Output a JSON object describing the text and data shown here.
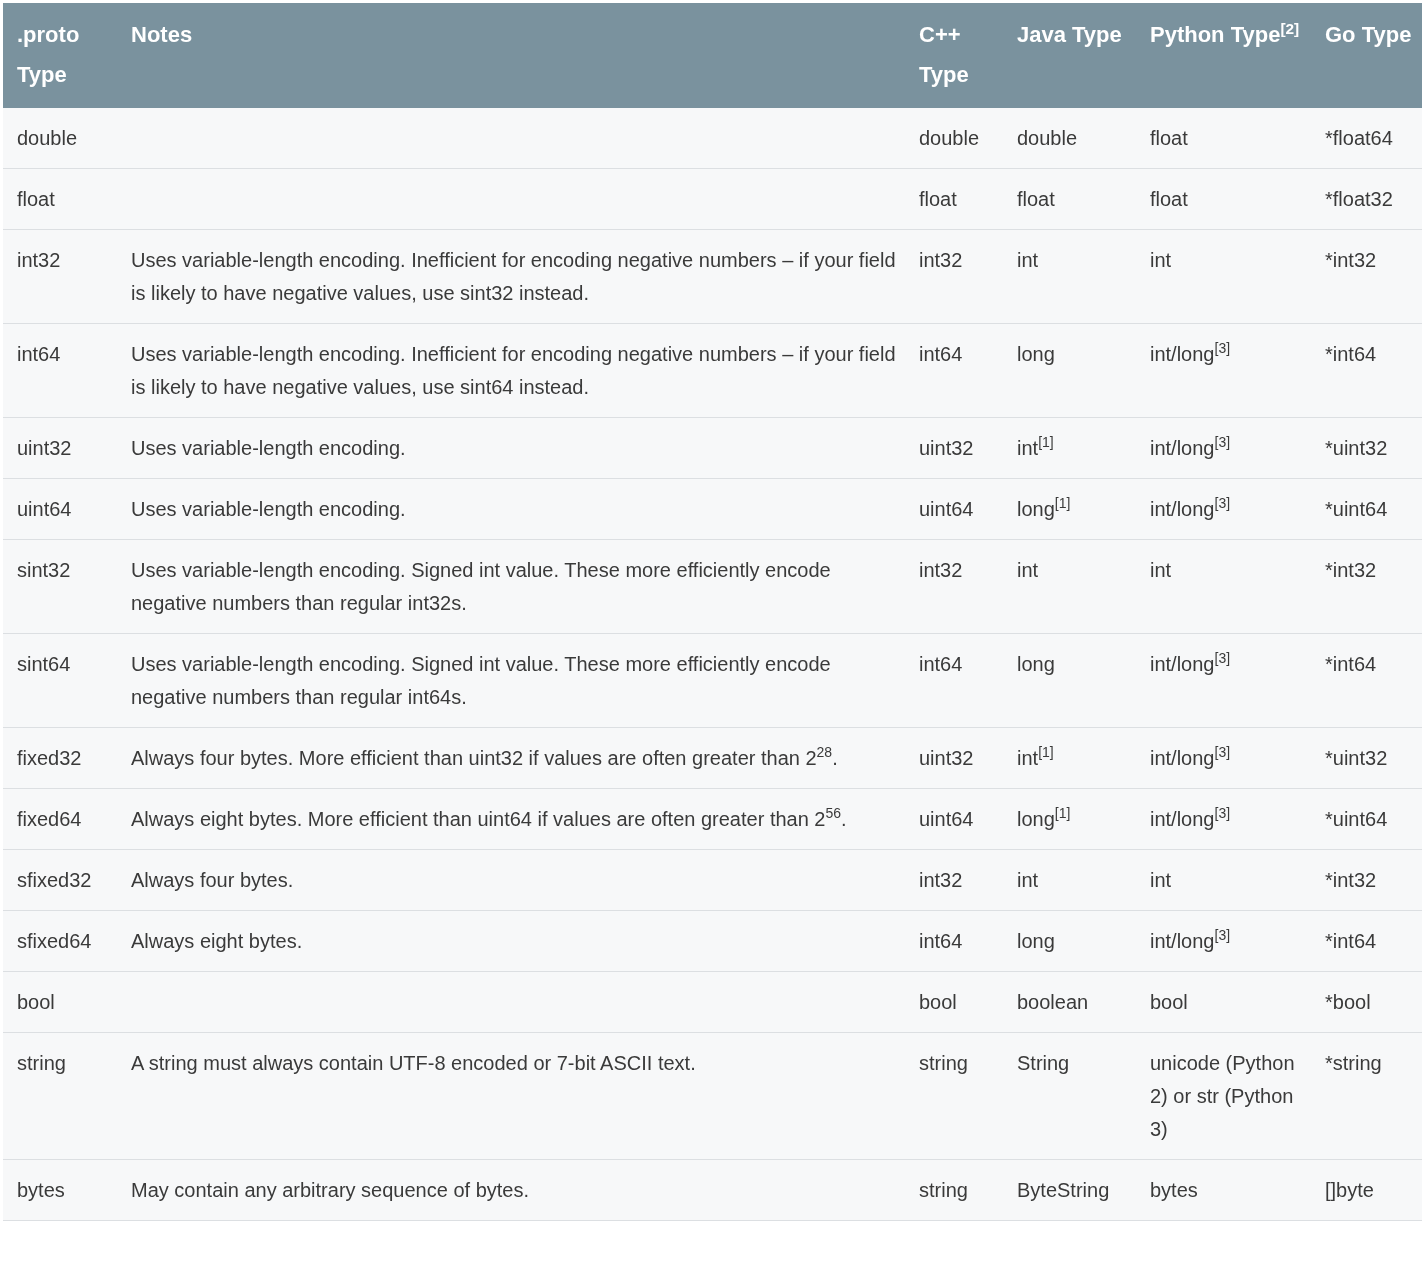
{
  "table": {
    "columns": [
      ".proto Type",
      "Notes",
      "C++ Type",
      "Java Type",
      "Python Type$^{[2]}$",
      "Go Type"
    ],
    "rows": [
      {
        "type": "double",
        "cpp": "double",
        "java": "double",
        "python": "float",
        "go": "*float64"
      },
      {
        "type": "float",
        "cpp": "float",
        "java": "float",
        "python": "float",
        "go": "*float32"
      },
      {
        "type": "int32",
        "notes": "Uses variable-length encoding. Inefficient for encoding negative numbers – if your field is likely to have negative values, use sint32 instead.",
        "cpp": "int32",
        "java": "int",
        "python": "int",
        "go": "*int32"
      },
      {
        "type": "int64",
        "notes": "Uses variable-length encoding. Inefficient for encoding negative numbers – if your field is likely to have negative values, use sint64 instead.",
        "cpp": "int64",
        "java": "long",
        "python": "int/long$^{[3]}$",
        "go": "*int64"
      },
      {
        "type": "uint32",
        "notes": "Uses variable-length encoding.",
        "cpp": "uint32",
        "java": "int$^{[1]}$",
        "python": "int/long$^{[3]}$",
        "go": "*uint32"
      },
      {
        "type": "uint64",
        "notes": "Uses variable-length encoding.",
        "cpp": "uint64",
        "java": "long$^{[1]}$",
        "python": "int/long$^{[3]}$",
        "go": "*uint64"
      },
      {
        "type": "sint32",
        "notes": "Uses variable-length encoding. Signed int value. These more efficiently encode negative numbers than regular int32s.",
        "cpp": "int32",
        "java": "int",
        "python": "int",
        "go": "*int32"
      },
      {
        "type": "sint64",
        "notes": "Uses variable-length encoding. Signed int value. These more efficiently encode negative numbers than regular int64s.",
        "cpp": "int64",
        "java": "long",
        "python": "int/long$^{[3]}$",
        "go": "*int64"
      },
      {
        "type": "fixed32",
        "notes": "Always four bytes. More efficient than uint32 if values are often greater than 2$^{28}$.",
        "cpp": "uint32",
        "java": "int$^{[1]}$",
        "python": "int/long$^{[3]}$",
        "go": "*uint32"
      },
      {
        "type": "fixed64",
        "notes": "Always eight bytes. More efficient than uint64 if values are often greater than 2$^{56}$.",
        "cpp": "uint64",
        "java": "long$^{[1]}$",
        "python": "int/long$^{[3]}$",
        "go": "*uint64"
      },
      {
        "type": "sfixed32",
        "notes": "Always four bytes.",
        "cpp": "int32",
        "java": "int",
        "python": "int",
        "go": "*int32"
      },
      {
        "type": "sfixed64",
        "notes": "Always eight bytes.",
        "cpp": "int64",
        "java": "long",
        "python": "int/long$^{[3]}$",
        "go": "*int64"
      },
      {
        "type": "bool",
        "cpp": "bool",
        "java": "boolean",
        "python": "bool",
        "go": "*bool"
      },
      {
        "type": "string",
        "notes": "A string must always contain UTF-8 encoded or 7-bit ASCII text.",
        "cpp": "string",
        "java": "String",
        "python": "unicode (Python 2) or str (Python 3)",
        "go": "*string"
      },
      {
        "type": "bytes",
        "notes": "May contain any arbitrary sequence of bytes.",
        "cpp": "string",
        "java": "ByteString",
        "python": "bytes",
        "go": "[]byte"
      }
    ]
  }
}
